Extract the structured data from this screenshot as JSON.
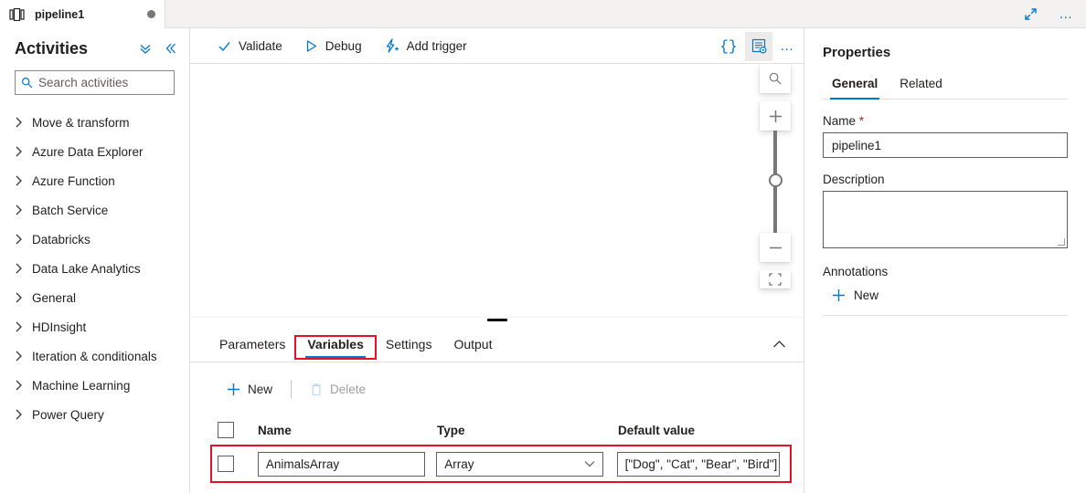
{
  "tabstrip": {
    "document_tab": {
      "title": "pipeline1",
      "icon": "pipeline-icon",
      "dirty": true
    },
    "maximize_label": "maximize-icon",
    "more_label": "…"
  },
  "activities": {
    "title": "Activities",
    "collapse_all_icon": "double-chevron-down-icon",
    "collapse_pane_icon": "double-chevron-left-icon",
    "search": {
      "placeholder": "Search activities",
      "value": ""
    },
    "items": [
      {
        "label": "Move & transform"
      },
      {
        "label": "Azure Data Explorer"
      },
      {
        "label": "Azure Function"
      },
      {
        "label": "Batch Service"
      },
      {
        "label": "Databricks"
      },
      {
        "label": "Data Lake Analytics"
      },
      {
        "label": "General"
      },
      {
        "label": "HDInsight"
      },
      {
        "label": "Iteration & conditionals"
      },
      {
        "label": "Machine Learning"
      },
      {
        "label": "Power Query"
      }
    ]
  },
  "toolbar": {
    "validate_label": "Validate",
    "debug_label": "Debug",
    "add_trigger_label": "Add trigger",
    "code_label": "{}",
    "properties_label": "properties-panel-icon",
    "more_label": "…"
  },
  "canvas": {
    "zoom_to_fit_icon": "magnifier-icon",
    "zoom_in_label": "+",
    "zoom_out_label": "−"
  },
  "bottom_tabs": {
    "tabs": [
      {
        "label": "Parameters",
        "active": false,
        "highlighted": false
      },
      {
        "label": "Variables",
        "active": true,
        "highlighted": true
      },
      {
        "label": "Settings",
        "active": false,
        "highlighted": false
      },
      {
        "label": "Output",
        "active": false,
        "highlighted": false
      }
    ],
    "collapse_icon": "chevron-up-icon"
  },
  "variables": {
    "new_label": "New",
    "delete_label": "Delete",
    "delete_disabled": true,
    "columns": [
      "Name",
      "Type",
      "Default value"
    ],
    "rows": [
      {
        "selected": false,
        "name": "AnimalsArray",
        "type": "Array",
        "default_value": "[\"Dog\", \"Cat\", \"Bear\", \"Bird\"]",
        "highlighted": true
      }
    ]
  },
  "properties": {
    "title": "Properties",
    "tabs": [
      {
        "label": "General",
        "active": true
      },
      {
        "label": "Related",
        "active": false
      }
    ],
    "name_label": "Name",
    "name_required_mark": "*",
    "name_value": "pipeline1",
    "description_label": "Description",
    "description_value": "",
    "annotations_label": "Annotations",
    "annotations_new_label": "New"
  },
  "colors": {
    "accent": "#0078d4",
    "annotation_red": "#e81123",
    "required_red": "#a4262c",
    "border": "#e1dfdd",
    "text": "#201f1e",
    "disabled": "#a19f9d"
  }
}
